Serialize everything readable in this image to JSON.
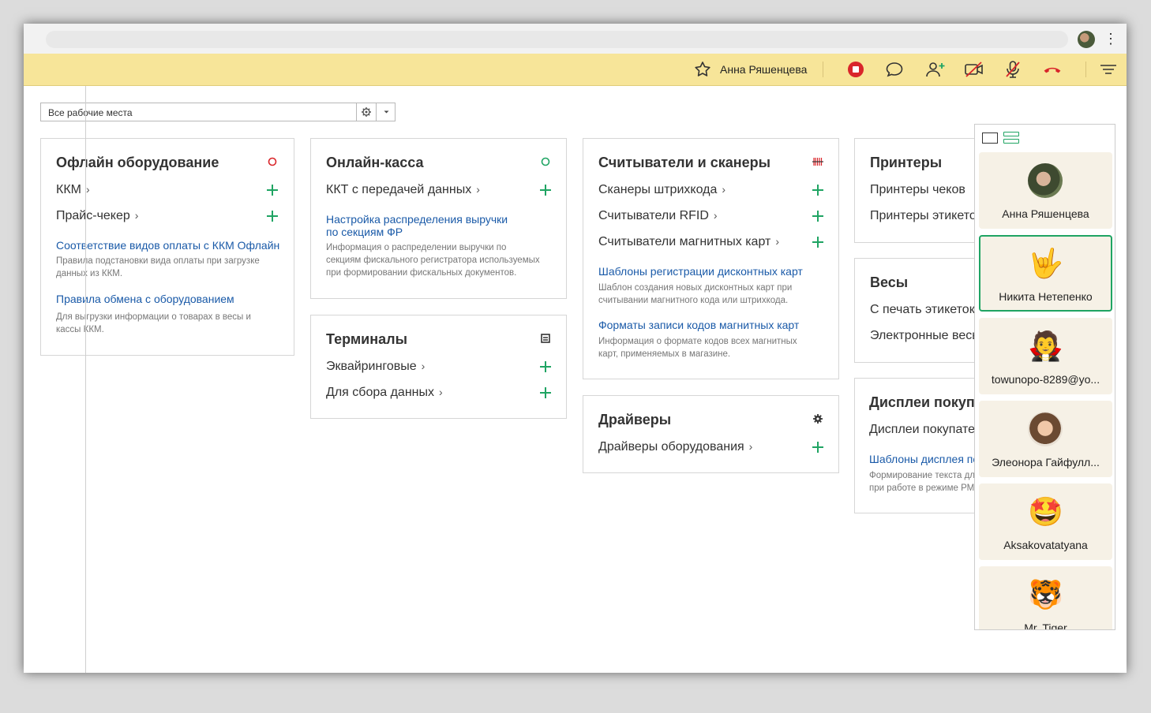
{
  "callbar": {
    "caller_name": "Анна Ряшенцева"
  },
  "workspace": {
    "selected": "Все рабочие места"
  },
  "cards": {
    "offline": {
      "title": "Офлайн оборудование",
      "rows": [
        "ККМ",
        "Прайс-чекер"
      ],
      "links": [
        {
          "title": "Соответствие видов оплаты с ККМ Офлайн",
          "desc1": "Правила подстановки вида оплаты при загрузке",
          "desc2": "данных из ККМ."
        },
        {
          "title": "Правила обмена с оборудованием",
          "desc1": "Для выгрузки информации о товарах в весы и",
          "desc2": "кассы ККМ."
        }
      ]
    },
    "online": {
      "title": "Онлайн-касса",
      "rows": [
        "ККТ с передачей данных"
      ],
      "link_title1": "Настройка распределения выручки",
      "link_title2": "по секциям ФР",
      "desc1": "Информация о распределении выручки по",
      "desc2": "секциям фискального регистратора используемых",
      "desc3": "при формировании фискальных документов."
    },
    "terminals": {
      "title": "Терминалы",
      "rows": [
        "Эквайринговые",
        "Для сбора данных"
      ]
    },
    "scanners": {
      "title": "Считыватели и сканеры",
      "rows": [
        "Сканеры штрихкода",
        "Считыватели RFID",
        "Считыватели магнитных карт"
      ],
      "links": [
        {
          "title": "Шаблоны регистрации дисконтных карт",
          "desc1": "Шаблон создания новых дисконтных карт при",
          "desc2": "считывании магнитного кода или штрихкода."
        },
        {
          "title": "Форматы записи кодов магнитных карт",
          "desc1": "Информация о формате кодов всех магнитных",
          "desc2": "карт, применяемых в магазине."
        }
      ]
    },
    "drivers": {
      "title": "Драйверы",
      "rows": [
        "Драйверы оборудования"
      ]
    },
    "printers": {
      "title": "Принтеры",
      "rows": [
        "Принтеры чеков",
        "Принтеры этикеток"
      ]
    },
    "scales": {
      "title": "Весы",
      "rows": [
        "С печать этикеток",
        "Электронные весы"
      ]
    },
    "displays": {
      "title": "Дисплеи покупателя",
      "rows": [
        "Дисплеи покупателя"
      ],
      "link_title": "Шаблоны дисплея покупателя",
      "desc1": "Формирование текста для вывода",
      "desc2": "при работе в режиме РМК."
    }
  },
  "participants": [
    {
      "name": "Анна Ряшенцева",
      "avatar": "photo-avatar"
    },
    {
      "name": "Никита Нетепенко",
      "avatar": "🤟",
      "active": true
    },
    {
      "name": "towunopo-8289@yo...",
      "avatar": "🧛"
    },
    {
      "name": "Элеонора Гайфулл...",
      "avatar": "photo-avatar"
    },
    {
      "name": "Aksakovatatyana",
      "avatar": "🤩"
    },
    {
      "name": "Mr. Tiger",
      "avatar": "🐯"
    }
  ],
  "colors": {
    "callbar_bg": "#f7e599",
    "accent_green": "#1fa463",
    "link_blue": "#1a5aa8",
    "end_call_red": "#d9252a"
  }
}
